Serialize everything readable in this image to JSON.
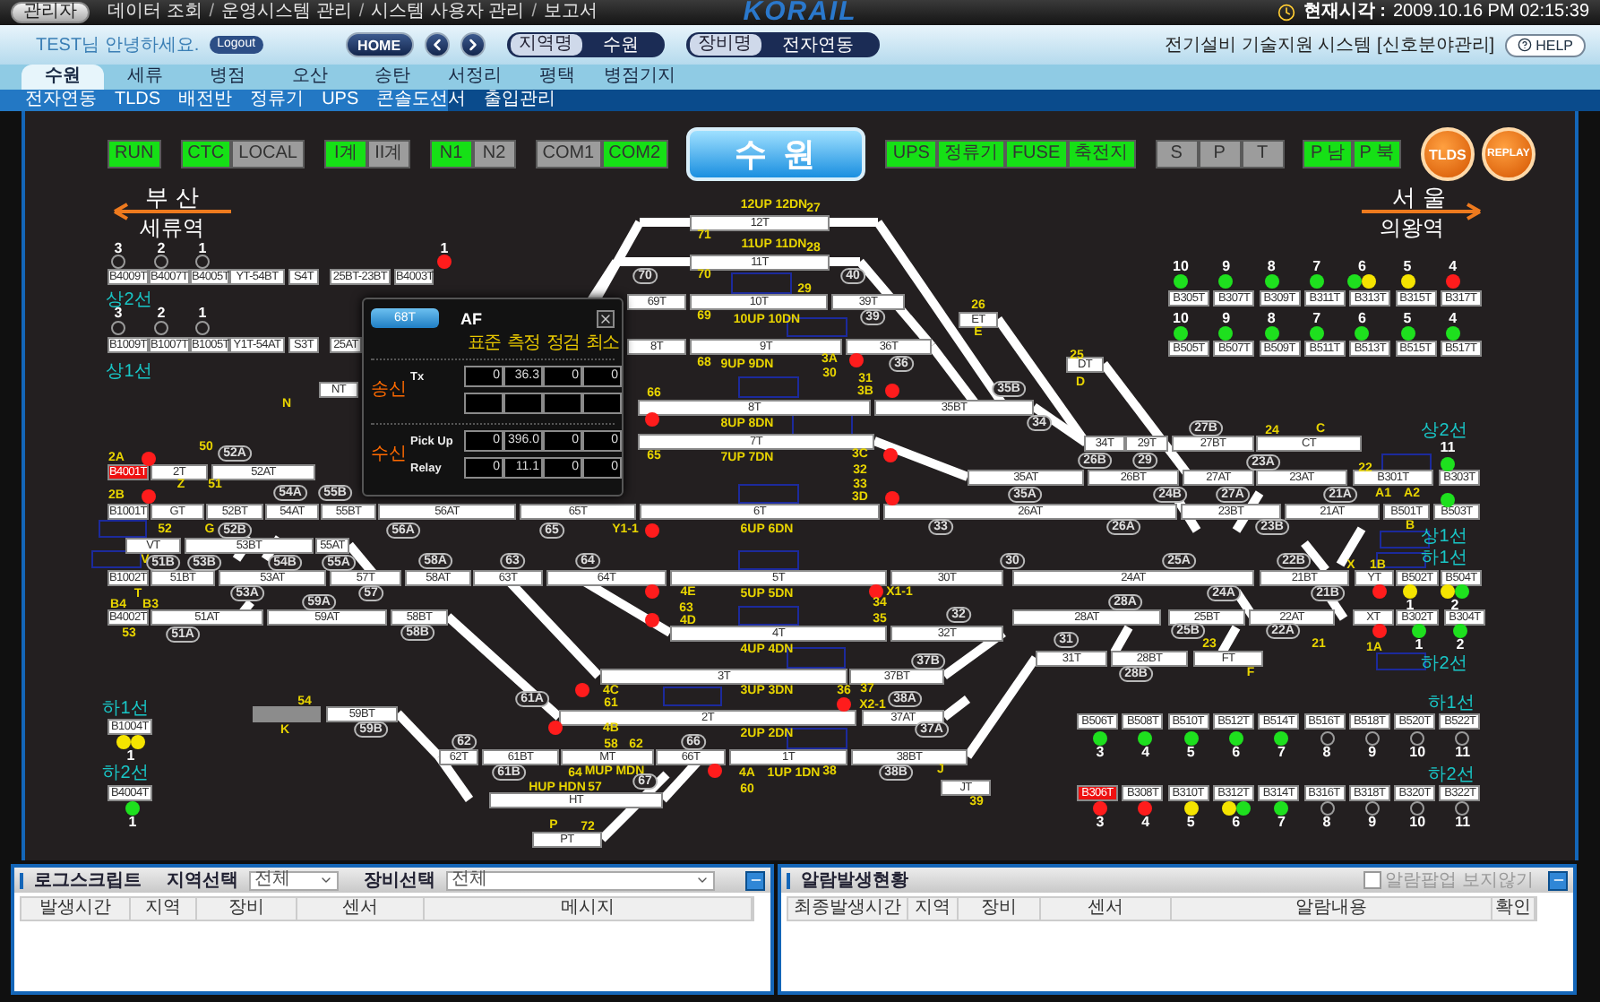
{
  "top_bar": {
    "user_button": "관리자",
    "menu": [
      "데이터 조회",
      "운영시스템 관리",
      "시스템 사용자 관리",
      "보고서"
    ],
    "separator": "/",
    "logo": "KORAIL",
    "clock_label": "현재시각 :",
    "clock": "2009.10.16 PM 02:15:39"
  },
  "info_bar": {
    "greeting": "TEST님 안녕하세요.",
    "logout": "Logout",
    "home": "HOME",
    "selectors": [
      {
        "label": "지역명",
        "value": "수원"
      },
      {
        "label": "장비명",
        "value": "전자연동"
      }
    ],
    "system_title": "전기설비 기술지원 시스템 [신호분야관리]",
    "help": "HELP"
  },
  "tabs": [
    {
      "label": "수원",
      "selected": true
    },
    {
      "label": "세류",
      "selected": false
    },
    {
      "label": "병점",
      "selected": false
    },
    {
      "label": "오산",
      "selected": false
    },
    {
      "label": "송탄",
      "selected": false
    },
    {
      "label": "서정리",
      "selected": false
    },
    {
      "label": "평택",
      "selected": false
    },
    {
      "label": "병점기지",
      "selected": false
    }
  ],
  "subtabs": [
    "전자연동",
    "TLDS",
    "배전반",
    "정류기",
    "UPS",
    "콘솔도선서",
    "출입관리"
  ],
  "controls": [
    {
      "buttons": [
        {
          "label": "RUN",
          "on": true
        }
      ]
    },
    {
      "buttons": [
        {
          "label": "CTC",
          "on": true
        },
        {
          "label": "LOCAL",
          "on": false
        }
      ]
    },
    {
      "buttons": [
        {
          "label": "I계",
          "on": true
        },
        {
          "label": "II계",
          "on": false
        }
      ]
    },
    {
      "buttons": [
        {
          "label": "N1",
          "on": true
        },
        {
          "label": "N2",
          "on": false
        }
      ]
    },
    {
      "buttons": [
        {
          "label": "COM1",
          "on": false
        },
        {
          "label": "COM2",
          "on": true
        }
      ]
    },
    {
      "buttons": [
        {
          "label": "UPS",
          "on": true
        },
        {
          "label": "정류기",
          "on": true
        },
        {
          "label": "FUSE",
          "on": true
        },
        {
          "label": "축전지",
          "on": true
        }
      ]
    },
    {
      "buttons": [
        {
          "label": "S",
          "on": false
        },
        {
          "label": "P",
          "on": false
        },
        {
          "label": "T",
          "on": false
        }
      ]
    },
    {
      "buttons": [
        {
          "label": "P 남",
          "on": true
        },
        {
          "label": "P 북",
          "on": true
        }
      ]
    }
  ],
  "station": "수 원",
  "round_buttons": [
    "TLDS",
    "REPLAY"
  ],
  "directions": [
    {
      "kind": "left",
      "city": "부 산",
      "station": "세류역"
    },
    {
      "kind": "right",
      "city": "서 울",
      "station": "의왕역"
    }
  ],
  "block_rows": [
    {
      "sections": [
        {
          "label": "B4009T",
          "occupied": false
        },
        {
          "label": "B4007T",
          "occupied": false
        },
        {
          "label": "B4005T",
          "occupied": false
        },
        {
          "label": "YT-54BT",
          "occupied": false
        },
        {
          "label": "S4T",
          "occupied": false
        },
        {
          "label": "25BT-23BT",
          "occupied": false
        },
        {
          "label": "B4003T",
          "occupied": false
        }
      ],
      "signals": [
        {
          "number": "3",
          "lit": false
        },
        {
          "number": "2",
          "lit": false
        },
        {
          "number": "1",
          "lit": false
        },
        {
          "number": "1",
          "lit": true,
          "lamps": [
            {
              "color": "#ff1c1c"
            }
          ]
        }
      ]
    },
    {
      "sections": [
        {
          "label": "B1009T",
          "occupied": false
        },
        {
          "label": "B1007T",
          "occupied": false
        },
        {
          "label": "B1005T",
          "occupied": false
        },
        {
          "label": "Y1T-54AT",
          "occupied": false
        },
        {
          "label": "S3T",
          "occupied": false
        },
        {
          "label": "25AT",
          "occupied": false
        }
      ],
      "signals": [
        {
          "number": "3",
          "lit": false
        },
        {
          "number": "2",
          "lit": false
        },
        {
          "number": "1",
          "lit": false
        }
      ]
    },
    {
      "sections": [
        {
          "label": "B305T",
          "occupied": false
        },
        {
          "label": "B307T",
          "occupied": false
        },
        {
          "label": "B309T",
          "occupied": false
        },
        {
          "label": "B311T",
          "occupied": false
        },
        {
          "label": "B313T",
          "occupied": false
        },
        {
          "label": "B315T",
          "occupied": false
        },
        {
          "label": "B317T",
          "occupied": false
        }
      ],
      "signals": [
        {
          "number": "10",
          "lit": true,
          "lamps": [
            {
              "color": "#1ee01e"
            }
          ]
        },
        {
          "number": "9",
          "lit": true,
          "lamps": [
            {
              "color": "#1ee01e"
            }
          ]
        },
        {
          "number": "8",
          "lit": true,
          "lamps": [
            {
              "color": "#1ee01e"
            }
          ]
        },
        {
          "number": "7",
          "lit": true,
          "lamps": [
            {
              "color": "#1ee01e"
            }
          ]
        },
        {
          "number": "6",
          "lit": true,
          "lamps": [
            {
              "color": "#1ee01e"
            },
            {
              "color": "#f5e400"
            }
          ]
        },
        {
          "number": "5",
          "lit": true,
          "lamps": [
            {
              "color": "#f5e400"
            }
          ]
        },
        {
          "number": "4",
          "lit": true,
          "lamps": [
            {
              "color": "#ff1c1c"
            }
          ]
        }
      ]
    },
    {
      "sections": [
        {
          "label": "B505T",
          "occupied": false
        },
        {
          "label": "B507T",
          "occupied": false
        },
        {
          "label": "B509T",
          "occupied": false
        },
        {
          "label": "B511T",
          "occupied": false
        },
        {
          "label": "B513T",
          "occupied": false
        },
        {
          "label": "B515T",
          "occupied": false
        },
        {
          "label": "B517T",
          "occupied": false
        }
      ],
      "signals": [
        {
          "number": "10",
          "lit": true,
          "lamps": [
            {
              "color": "#1ee01e"
            }
          ]
        },
        {
          "number": "9",
          "lit": true,
          "lamps": [
            {
              "color": "#1ee01e"
            }
          ]
        },
        {
          "number": "8",
          "lit": true,
          "lamps": [
            {
              "color": "#1ee01e"
            }
          ]
        },
        {
          "number": "7",
          "lit": true,
          "lamps": [
            {
              "color": "#1ee01e"
            }
          ]
        },
        {
          "number": "6",
          "lit": true,
          "lamps": [
            {
              "color": "#1ee01e"
            }
          ]
        },
        {
          "number": "5",
          "lit": true,
          "lamps": [
            {
              "color": "#1ee01e"
            }
          ]
        },
        {
          "number": "4",
          "lit": true,
          "lamps": [
            {
              "color": "#1ee01e"
            }
          ]
        }
      ]
    },
    {
      "sections": [
        {
          "label": "B506T",
          "occupied": false
        },
        {
          "label": "B508T",
          "occupied": false
        },
        {
          "label": "B510T",
          "occupied": false
        },
        {
          "label": "B512T",
          "occupied": false
        },
        {
          "label": "B514T",
          "occupied": false
        },
        {
          "label": "B516T",
          "occupied": false
        },
        {
          "label": "B518T",
          "occupied": false
        },
        {
          "label": "B520T",
          "occupied": false
        },
        {
          "label": "B522T",
          "occupied": false
        }
      ],
      "signals": [
        {
          "number": "3",
          "lit": true,
          "lamps": [
            {
              "color": "#1ee01e"
            }
          ]
        },
        {
          "number": "4",
          "lit": true,
          "lamps": [
            {
              "color": "#1ee01e"
            }
          ]
        },
        {
          "number": "5",
          "lit": true,
          "lamps": [
            {
              "color": "#1ee01e"
            }
          ]
        },
        {
          "number": "6",
          "lit": true,
          "lamps": [
            {
              "color": "#1ee01e"
            }
          ]
        },
        {
          "number": "7",
          "lit": true,
          "lamps": [
            {
              "color": "#1ee01e"
            }
          ]
        },
        {
          "number": "8",
          "lit": false
        },
        {
          "number": "9",
          "lit": false
        },
        {
          "number": "10",
          "lit": false
        },
        {
          "number": "11",
          "lit": false
        }
      ]
    },
    {
      "sections": [
        {
          "label": "B306T",
          "occupied": true
        },
        {
          "label": "B308T",
          "occupied": false
        },
        {
          "label": "B310T",
          "occupied": false
        },
        {
          "label": "B312T",
          "occupied": false
        },
        {
          "label": "B314T",
          "occupied": false
        },
        {
          "label": "B316T",
          "occupied": false
        },
        {
          "label": "B318T",
          "occupied": false
        },
        {
          "label": "B320T",
          "occupied": false
        },
        {
          "label": "B322T",
          "occupied": false
        }
      ],
      "signals": [
        {
          "number": "3",
          "lit": true,
          "lamps": [
            {
              "color": "#ff1c1c"
            }
          ]
        },
        {
          "number": "4",
          "lit": true,
          "lamps": [
            {
              "color": "#ff1c1c"
            }
          ]
        },
        {
          "number": "5",
          "lit": true,
          "lamps": [
            {
              "color": "#f5e400"
            }
          ]
        },
        {
          "number": "6",
          "lit": true,
          "lamps": [
            {
              "color": "#f5e400"
            },
            {
              "color": "#1ee01e"
            }
          ]
        },
        {
          "number": "7",
          "lit": true,
          "lamps": [
            {
              "color": "#1ee01e"
            }
          ]
        },
        {
          "number": "8",
          "lit": false
        },
        {
          "number": "9",
          "lit": false
        },
        {
          "number": "10",
          "lit": false
        },
        {
          "number": "11",
          "lit": false
        }
      ]
    },
    {
      "sections": [
        {
          "label": "B1004T",
          "occupied": false
        }
      ],
      "signals": [
        {
          "number": "1",
          "lit": true,
          "lamps": [
            {
              "color": "#f5e400"
            },
            {
              "color": "#f5e400"
            }
          ]
        }
      ]
    },
    {
      "sections": [
        {
          "label": "B4004T",
          "occupied": false
        }
      ],
      "signals": [
        {
          "number": "1",
          "lit": true,
          "lamps": [
            {
              "color": "#1ee01e"
            }
          ]
        }
      ]
    }
  ],
  "tracks": [
    {
      "label": "12T",
      "occupied": false
    },
    {
      "label": "11T",
      "occupied": false
    },
    {
      "label": "69T",
      "occupied": false
    },
    {
      "label": "10T",
      "occupied": false
    },
    {
      "label": "39T",
      "occupied": false
    },
    {
      "label": "8T",
      "occupied": false
    },
    {
      "label": "9T",
      "occupied": false
    },
    {
      "label": "36T",
      "occupied": false
    },
    {
      "label": "ET",
      "occupied": false
    },
    {
      "label": "DT",
      "occupied": false
    },
    {
      "label": "NT",
      "occupied": false
    },
    {
      "label": "8T",
      "occupied": false
    },
    {
      "label": "35BT",
      "occupied": false
    },
    {
      "label": "7T",
      "occupied": false
    },
    {
      "label": "34T",
      "occupied": false
    },
    {
      "label": "29T",
      "occupied": false
    },
    {
      "label": "27BT",
      "occupied": false
    },
    {
      "label": "CT",
      "occupied": false
    },
    {
      "label": "B4001T",
      "occupied": true
    },
    {
      "label": "2T",
      "occupied": false
    },
    {
      "label": "52AT",
      "occupied": false
    },
    {
      "label": "35AT",
      "occupied": false
    },
    {
      "label": "26BT",
      "occupied": false
    },
    {
      "label": "27AT",
      "occupied": false
    },
    {
      "label": "23AT",
      "occupied": false
    },
    {
      "label": "B301T",
      "occupied": false
    },
    {
      "label": "B303T",
      "occupied": false
    },
    {
      "label": "B1001T",
      "occupied": false
    },
    {
      "label": "GT",
      "occupied": false
    },
    {
      "label": "52BT",
      "occupied": false
    },
    {
      "label": "54AT",
      "occupied": false
    },
    {
      "label": "55BT",
      "occupied": false
    },
    {
      "label": "56AT",
      "occupied": false
    },
    {
      "label": "65T",
      "occupied": false
    },
    {
      "label": "6T",
      "occupied": false
    },
    {
      "label": "26AT",
      "occupied": false
    },
    {
      "label": "23BT",
      "occupied": false
    },
    {
      "label": "21AT",
      "occupied": false
    },
    {
      "label": "B501T",
      "occupied": false
    },
    {
      "label": "B503T",
      "occupied": false
    },
    {
      "label": "VT",
      "occupied": false
    },
    {
      "label": "53BT",
      "occupied": false
    },
    {
      "label": "55AT",
      "occupied": false
    },
    {
      "label": "B1002T",
      "occupied": false
    },
    {
      "label": "51BT",
      "occupied": false
    },
    {
      "label": "53AT",
      "occupied": false
    },
    {
      "label": "57T",
      "occupied": false
    },
    {
      "label": "58AT",
      "occupied": false
    },
    {
      "label": "63T",
      "occupied": false
    },
    {
      "label": "64T",
      "occupied": false
    },
    {
      "label": "5T",
      "occupied": false
    },
    {
      "label": "30T",
      "occupied": false
    },
    {
      "label": "24AT",
      "occupied": false
    },
    {
      "label": "21BT",
      "occupied": false
    },
    {
      "label": "YT",
      "occupied": false
    },
    {
      "label": "B502T",
      "occupied": false
    },
    {
      "label": "B504T",
      "occupied": false
    },
    {
      "label": "B4002T",
      "occupied": false
    },
    {
      "label": "51AT",
      "occupied": false
    },
    {
      "label": "59AT",
      "occupied": false
    },
    {
      "label": "58BT",
      "occupied": false
    },
    {
      "label": "28AT",
      "occupied": false
    },
    {
      "label": "25BT",
      "occupied": false
    },
    {
      "label": "22AT",
      "occupied": false
    },
    {
      "label": "XT",
      "occupied": false
    },
    {
      "label": "B302T",
      "occupied": false
    },
    {
      "label": "B304T",
      "occupied": false
    },
    {
      "label": "4T",
      "occupied": false
    },
    {
      "label": "32T",
      "occupied": false
    },
    {
      "label": "3T",
      "occupied": false
    },
    {
      "label": "37BT",
      "occupied": false
    },
    {
      "label": "31T",
      "occupied": false
    },
    {
      "label": "28BT",
      "occupied": false
    },
    {
      "label": "FT",
      "occupied": false
    },
    {
      "label": "59BT",
      "occupied": false
    },
    {
      "label": "2T",
      "occupied": false
    },
    {
      "label": "37AT",
      "occupied": false
    },
    {
      "label": "62T",
      "occupied": false
    },
    {
      "label": "61BT",
      "occupied": false
    },
    {
      "label": "MT",
      "occupied": false
    },
    {
      "label": "66T",
      "occupied": false
    },
    {
      "label": "1T",
      "occupied": false
    },
    {
      "label": "38BT",
      "occupied": false
    },
    {
      "label": "JT",
      "occupied": false
    },
    {
      "label": "HT",
      "occupied": false
    },
    {
      "label": "PT",
      "occupied": false
    }
  ],
  "signals": [
    {
      "lit": true,
      "lamps": [
        {
          "color": "#ff1c1c"
        }
      ]
    },
    {
      "lit": true,
      "lamps": [
        {
          "color": "#ff1c1c"
        }
      ]
    },
    {
      "lit": true,
      "lamps": [
        {
          "color": "#ff1c1c"
        }
      ]
    },
    {
      "lit": true,
      "lamps": [
        {
          "color": "#ff1c1c"
        }
      ]
    },
    {
      "lit": true,
      "lamps": [
        {
          "color": "#ff1c1c"
        }
      ]
    },
    {
      "lit": true,
      "lamps": [
        {
          "color": "#ff1c1c"
        }
      ]
    },
    {
      "lit": true,
      "lamps": [
        {
          "color": "#ff1c1c"
        }
      ]
    },
    {
      "lit": true,
      "lamps": [
        {
          "color": "#ff1c1c"
        }
      ]
    },
    {
      "lit": true,
      "lamps": [
        {
          "color": "#ff1c1c"
        }
      ]
    },
    {
      "lit": true,
      "lamps": [
        {
          "color": "#ff1c1c"
        }
      ]
    },
    {
      "lit": true,
      "lamps": [
        {
          "color": "#ff1c1c"
        }
      ]
    },
    {
      "lit": true,
      "lamps": [
        {
          "color": "#ff1c1c"
        }
      ]
    },
    {
      "lit": true,
      "lamps": [
        {
          "color": "#ff1c1c"
        }
      ]
    },
    {
      "lit": true,
      "lamps": [
        {
          "color": "#ff1c1c"
        }
      ]
    },
    {
      "lit": true,
      "lamps": [
        {
          "color": "#ff1c1c"
        }
      ]
    },
    {
      "number": "11",
      "lit": true,
      "lamps": [
        {
          "color": "#1ee01e"
        }
      ]
    },
    {
      "lit": true,
      "lamps": [
        {
          "color": "#1ee01e"
        }
      ]
    },
    {
      "lit": true,
      "lamps": [
        {
          "color": "#ff1c1c"
        }
      ]
    },
    {
      "number": "1",
      "lit": true,
      "lamps": [
        {
          "color": "#f5e400"
        }
      ]
    },
    {
      "number": "2",
      "lit": true,
      "lamps": [
        {
          "color": "#f5e400"
        },
        {
          "color": "#1ee01e"
        }
      ]
    },
    {
      "lit": true,
      "lamps": [
        {
          "color": "#ff1c1c"
        }
      ]
    },
    {
      "number": "1",
      "lit": true,
      "lamps": [
        {
          "color": "#1ee01e"
        }
      ]
    },
    {
      "number": "2",
      "lit": true,
      "lamps": [
        {
          "color": "#1ee01e"
        }
      ]
    }
  ],
  "route_labels": [
    "12UP 12DN",
    "27",
    "71",
    "11UP 11DN",
    "28",
    "70",
    "29",
    "69",
    "10UP 10DN",
    "26",
    "E",
    "68",
    "9UP 9DN",
    "3A",
    "30",
    "25",
    "D",
    "31",
    "3B",
    "66",
    "8UP 8DN",
    "65",
    "7UP 7DN",
    "3C",
    "32",
    "33",
    "3D",
    "2A",
    "50",
    "2B",
    "Z",
    "51",
    "N",
    "52",
    "G",
    "Y1-1",
    "6UP 6DN",
    "V",
    "T",
    "4E",
    "5UP 5DN",
    "X1-1",
    "B4",
    "B3",
    "63",
    "34",
    "4D",
    "35",
    "53",
    "4UP 4DN",
    "54",
    "K",
    "4C",
    "61",
    "3UP 3DN",
    "36",
    "37",
    "X2-1",
    "4B",
    "58",
    "2UP 2DN",
    "62",
    "64",
    "MUP MDN",
    "4A",
    "1UP 1DN",
    "38",
    "J",
    "HUP HDN",
    "57",
    "60",
    "39",
    "P",
    "72",
    "24",
    "C",
    "22",
    "A1",
    "A2",
    "B",
    "X",
    "1B",
    "23",
    "21",
    "1A",
    "F"
  ],
  "point_labels": [
    "52A",
    "54A",
    "55B",
    "52B",
    "56A",
    "65",
    "51B",
    "53B",
    "54B",
    "55A",
    "58A",
    "63",
    "64",
    "53A",
    "59A",
    "57",
    "51A",
    "58B",
    "61A",
    "59B",
    "62",
    "61B",
    "67",
    "66",
    "33",
    "30",
    "32",
    "37B",
    "31",
    "38A",
    "37A",
    "38B",
    "70",
    "40",
    "39",
    "36",
    "35B",
    "34",
    "26B",
    "29",
    "35A",
    "27B",
    "23A",
    "24B",
    "27A",
    "21A",
    "26A",
    "23B",
    "25A",
    "22B",
    "24A",
    "21B",
    "28A",
    "25B",
    "22A",
    "28B"
  ],
  "line_labels": [
    "상2선",
    "상1선",
    "하1선",
    "하2선",
    "상2선",
    "상1선",
    "하1선",
    "하2선",
    "하1선",
    "하2선"
  ],
  "popup": {
    "tab": "68T",
    "title": "AF",
    "columns": [
      "표준",
      "측정",
      "정검",
      "최소"
    ],
    "groups": [
      {
        "label": "송신",
        "rows": [
          {
            "kind": "values",
            "label": "Tx",
            "values": [
              "0",
              "36.3",
              "0",
              "0"
            ]
          },
          {
            "kind": "blank"
          }
        ]
      },
      {
        "label": "수신",
        "rows": [
          {
            "kind": "values",
            "label": "Pick Up",
            "values": [
              "0",
              "396.0",
              "0",
              "0"
            ]
          },
          {
            "kind": "values",
            "label": "Relay",
            "values": [
              "0",
              "11.1",
              "0",
              "0"
            ]
          }
        ]
      }
    ]
  },
  "log_panel": {
    "title": "로그스크립트",
    "filters": [
      {
        "label": "지역선택",
        "value": "전체"
      },
      {
        "label": "장비선택",
        "value": "전체"
      }
    ],
    "columns": [
      "발생시간",
      "지역",
      "장비",
      "센서",
      "메시지"
    ]
  },
  "alarm_panel": {
    "title": "알람발생현황",
    "option": {
      "label": "알람팝업 보지않기",
      "checked": false
    },
    "columns": [
      "최종발생시간",
      "지역",
      "장비",
      "센서",
      "알람내용",
      "확인"
    ]
  }
}
